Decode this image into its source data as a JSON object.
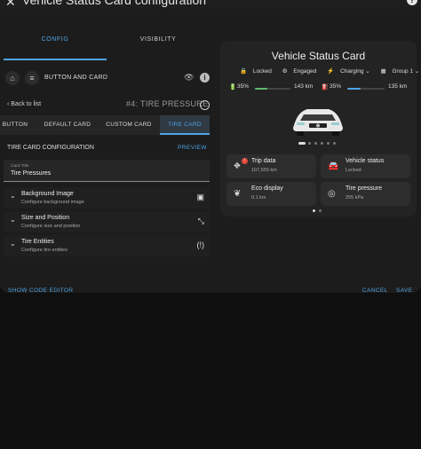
{
  "dialog": {
    "title": "Vehicle Status Card configuration",
    "close_icon": "close-icon",
    "help_icon": "help-icon"
  },
  "tabs": [
    "CONFIG",
    "VISIBILITY"
  ],
  "header_row": {
    "label": "BUTTON AND CARD"
  },
  "nav": {
    "back_label": "Back to list",
    "section_title": "#4: TIRE PRESSURE"
  },
  "subtabs": [
    "BUTTON",
    "DEFAULT CARD",
    "CUSTOM CARD",
    "TIRE CARD"
  ],
  "tire_card": {
    "heading": "TIRE CARD CONFIGURATION",
    "preview_label": "PREVIEW",
    "card_title_label": "Card Title",
    "card_title_value": "Tire Pressures"
  },
  "accordions": [
    {
      "title": "Background Image",
      "subtitle": "Configure background image",
      "icon": "image-icon"
    },
    {
      "title": "Size and Position",
      "subtitle": "Configure size and position",
      "icon": "resize-icon"
    },
    {
      "title": "Tire Entities",
      "subtitle": "Configure tire entities",
      "icon": "tire-alert-icon"
    }
  ],
  "footer": {
    "show_code": "SHOW CODE EDITOR",
    "cancel": "CANCEL",
    "save": "SAVE"
  },
  "preview_card": {
    "title": "Vehicle Status Card",
    "badges": [
      {
        "icon": "lock-icon",
        "label": "Locked"
      },
      {
        "icon": "engine-icon",
        "label": "Engaged"
      },
      {
        "icon": "charging-icon",
        "label": "Charging ⌄"
      },
      {
        "icon": "group-icon",
        "label": "Group 1 ⌄"
      }
    ],
    "ranges": [
      {
        "percent": "35%",
        "range": "143 km",
        "level": 0.35,
        "color": "#5fb96b"
      },
      {
        "percent": "35%",
        "range": "135 km",
        "level": 0.35,
        "color": "#4fa3e3"
      }
    ],
    "tiles": [
      {
        "icon": "trip-icon",
        "title": "Trip data",
        "subtitle": "107,555 km",
        "alert": "!"
      },
      {
        "icon": "vehicle-icon",
        "title": "Vehicle status",
        "subtitle": "Locked"
      },
      {
        "icon": "leaf-icon",
        "title": "Eco display",
        "subtitle": "0.1 km"
      },
      {
        "icon": "tire-icon",
        "title": "Tire pressure",
        "subtitle": "255 kPa"
      }
    ]
  }
}
